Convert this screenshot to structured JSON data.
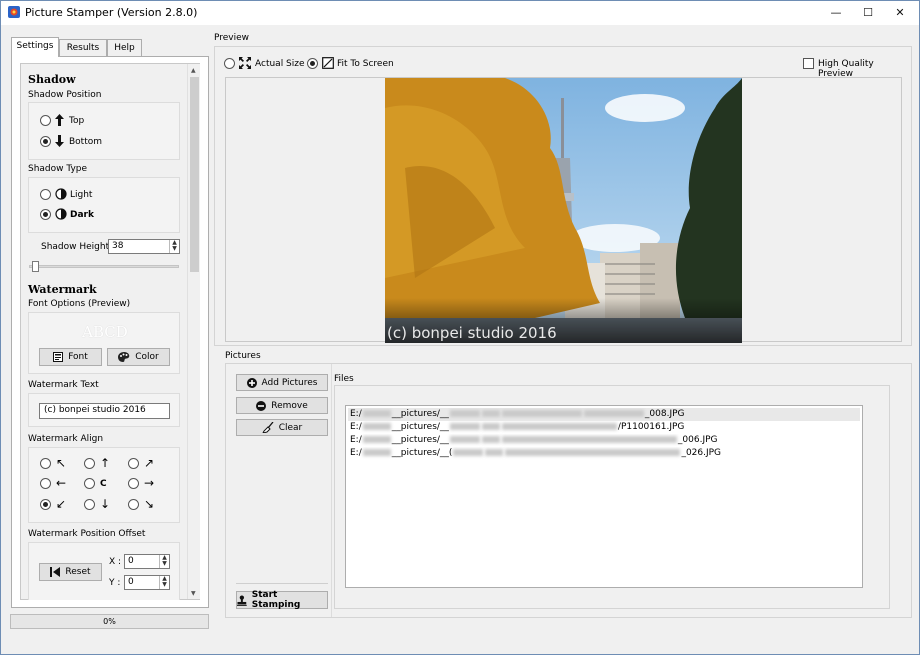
{
  "window": {
    "title": "Picture Stamper (Version 2.8.0)",
    "controls": {
      "minimize": "—",
      "maximize": "☐",
      "close": "✕"
    }
  },
  "tabs": [
    {
      "label": "Settings",
      "active": true
    },
    {
      "label": "Results",
      "active": false
    },
    {
      "label": "Help",
      "active": false
    }
  ],
  "settings": {
    "shadow": {
      "title": "Shadow",
      "position_label": "Shadow Position",
      "position_options": [
        {
          "label": "Top",
          "checked": false
        },
        {
          "label": "Bottom",
          "checked": true
        }
      ],
      "type_label": "Shadow Type",
      "type_options": [
        {
          "label": "Light",
          "checked": false
        },
        {
          "label": "Dark",
          "checked": true
        }
      ],
      "height_label": "Shadow Height :",
      "height_value": "38"
    },
    "watermark": {
      "title": "Watermark",
      "font_options_label": "Font Options (Preview)",
      "font_preview": "ABCD",
      "font_button": "Font",
      "color_button": "Color",
      "text_label": "Watermark Text",
      "text_value": "(c) bonpei studio 2016",
      "align_label": "Watermark Align",
      "align_center": "C",
      "align_arrows": [
        "↖",
        "↑",
        "↗",
        "←",
        "C",
        "→",
        "↙",
        "↓",
        "↘"
      ],
      "align_selected": 6,
      "offset_label": "Watermark Position Offset",
      "reset_button": "Reset",
      "x_label": "X :",
      "x_value": "0",
      "y_label": "Y :",
      "y_value": "0"
    }
  },
  "progress": {
    "text": "0%",
    "value": 0
  },
  "preview": {
    "label": "Preview",
    "actual_size": "Actual Size",
    "fit_to_screen": "Fit To Screen",
    "fit_selected": true,
    "high_quality": "High Quality Preview",
    "high_quality_checked": false,
    "watermark_overlay": "(c) bonpei studio 2016"
  },
  "pictures": {
    "label": "Pictures",
    "add_button": "Add Pictures",
    "remove_button": "Remove",
    "clear_button": "Clear",
    "start_button": "Start Stamping",
    "files_label": "Files",
    "files": [
      {
        "prefix": "E:/",
        "mid": "__pictures/__",
        "suffix": "_008.JPG",
        "selected": true
      },
      {
        "prefix": "E:/",
        "mid": "__pictures/__",
        "suffix": "/P1100161.JPG",
        "selected": false
      },
      {
        "prefix": "E:/",
        "mid": "__pictures/__",
        "suffix": "_006.JPG",
        "selected": false
      },
      {
        "prefix": "E:/",
        "mid": "__pictures/__(",
        "suffix": "_026.JPG",
        "selected": false
      }
    ]
  },
  "colors": {
    "accent_border": "#6e8db4",
    "sky": "#9fc7e8",
    "foliage": "#c98a1c"
  }
}
